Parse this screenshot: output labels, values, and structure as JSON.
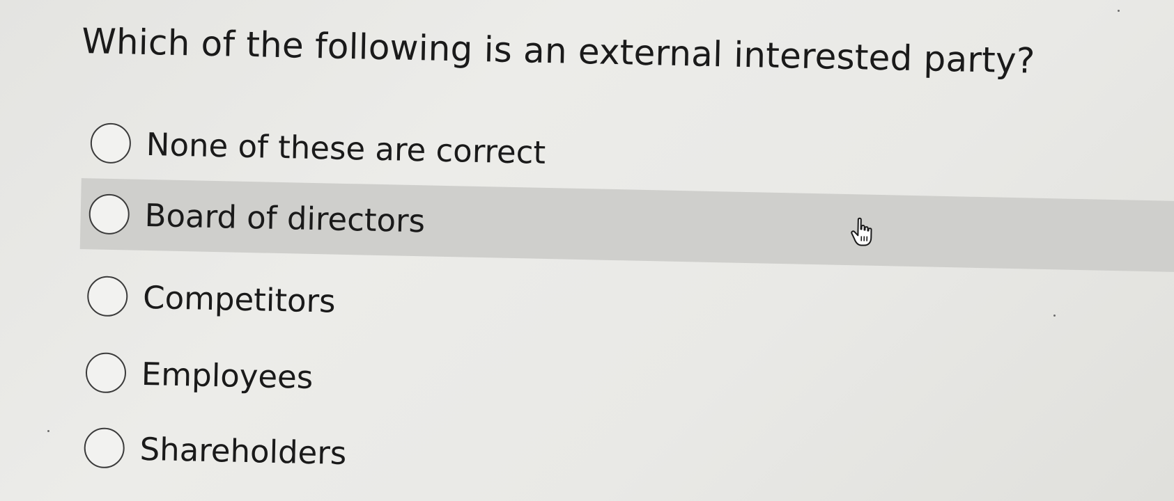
{
  "question": {
    "text": "Which of the following is an external interested party?"
  },
  "options": [
    {
      "label": "None of these are correct",
      "selected": false,
      "hovered": false
    },
    {
      "label": "Board of directors",
      "selected": false,
      "hovered": true
    },
    {
      "label": "Competitors",
      "selected": false,
      "hovered": false
    },
    {
      "label": "Employees",
      "selected": false,
      "hovered": false
    },
    {
      "label": "Shareholders",
      "selected": false,
      "hovered": false
    }
  ],
  "cursor": {
    "icon": "hand-pointer-icon"
  },
  "colors": {
    "hover_background": "#cfcfcc",
    "text": "#1a1a1a",
    "radio_border": "#3a3a3a"
  }
}
